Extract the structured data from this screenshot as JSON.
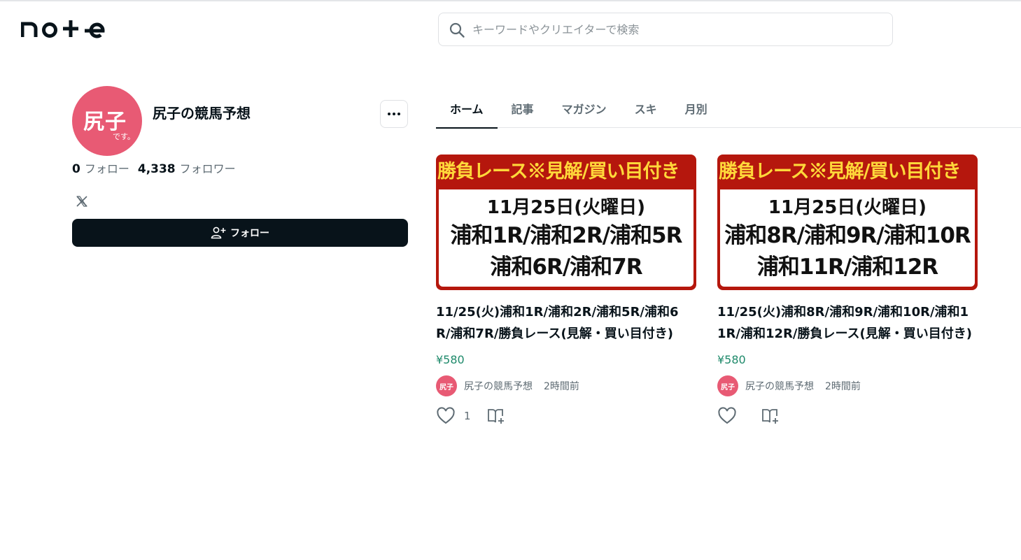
{
  "header": {
    "logo": "note",
    "search_placeholder": "キーワードやクリエイターで検索"
  },
  "profile": {
    "avatar_main": "尻子",
    "avatar_sub": "です。",
    "name": "尻子の競馬予想",
    "following_count": "0",
    "following_label": "フォロー",
    "follower_count": "4,338",
    "follower_label": "フォロワー",
    "social_icon": "x-icon",
    "follow_button": "フォロー"
  },
  "tabs": [
    {
      "label": "ホーム",
      "active": true
    },
    {
      "label": "記事",
      "active": false
    },
    {
      "label": "マガジン",
      "active": false
    },
    {
      "label": "スキ",
      "active": false
    },
    {
      "label": "月別",
      "active": false
    }
  ],
  "articles": [
    {
      "thumb_banner": "勝負レース※見解/買い目付き",
      "thumb_line1": "11月25日(火曜日)",
      "thumb_line2": "浦和1R/浦和2R/浦和5R",
      "thumb_line3": "浦和6R/浦和7R",
      "title": "11/25(火)浦和1R/浦和2R/浦和5R/浦和6R/浦和7R/勝負レース(見解・買い目付き)",
      "price": "¥580",
      "author_avatar": "尻子",
      "author": "尻子の競馬予想",
      "time": "2時間前",
      "likes": "1"
    },
    {
      "thumb_banner": "勝負レース※見解/買い目付き",
      "thumb_line1": "11月25日(火曜日)",
      "thumb_line2": "浦和8R/浦和9R/浦和10R",
      "thumb_line3": "浦和11R/浦和12R",
      "title": "11/25(火)浦和8R/浦和9R/浦和10R/浦和11R/浦和12R/勝負レース(見解・買い目付き)",
      "price": "¥580",
      "author_avatar": "尻子",
      "author": "尻子の競馬予想",
      "time": "2時間前",
      "likes": ""
    }
  ],
  "colors": {
    "accent_dark": "#08131a",
    "avatar_pink": "#e85a74",
    "price_green": "#1f8a6b",
    "thumb_red": "#b5170d",
    "thumb_yellow": "#ffd83a"
  }
}
